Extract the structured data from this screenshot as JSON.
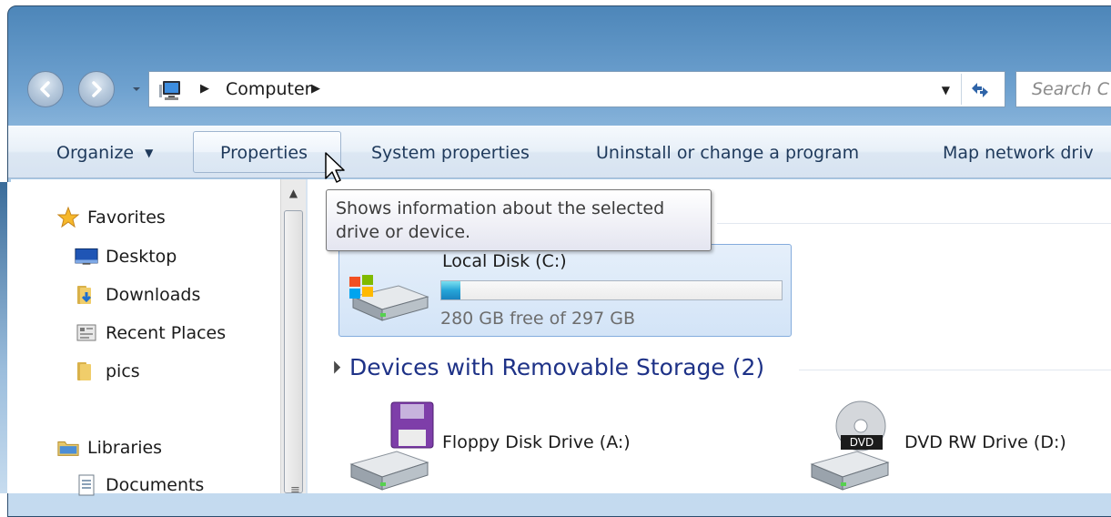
{
  "window": {
    "address_crumb": "Computer",
    "search_placeholder": "Search C"
  },
  "toolbar": {
    "organize_label": "Organize",
    "properties_label": "Properties",
    "system_properties_label": "System properties",
    "uninstall_label": "Uninstall or change a program",
    "map_network_label": "Map network driv"
  },
  "tooltip": {
    "line1": "Shows information about the selected",
    "line2": "drive or device."
  },
  "nav": {
    "favorites_label": "Favorites",
    "items": [
      {
        "label": "Desktop",
        "icon": "desktop-icon"
      },
      {
        "label": "Downloads",
        "icon": "downloads-folder-icon"
      },
      {
        "label": "Recent Places",
        "icon": "recent-places-icon"
      },
      {
        "label": "pics",
        "icon": "folder-icon"
      }
    ],
    "libraries_label": "Libraries",
    "library_items": [
      {
        "label": "Documents",
        "icon": "documents-icon"
      }
    ]
  },
  "main": {
    "drives": [
      {
        "name": "Local Disk (C:)",
        "free_text": "280 GB free of 297 GB",
        "used_fraction": 0.057
      }
    ],
    "removable_group_title": "Devices with Removable Storage (2)",
    "removable_devices": [
      {
        "name": "Floppy Disk Drive (A:)",
        "icon": "floppy-drive-icon"
      },
      {
        "name": "DVD RW Drive (D:)",
        "icon": "dvd-drive-icon"
      }
    ]
  },
  "colors": {
    "group_title": "#1e3287",
    "command_text": "#1e395b",
    "selection": "#d3e4f7",
    "usage_fill": "#26a5d8"
  }
}
